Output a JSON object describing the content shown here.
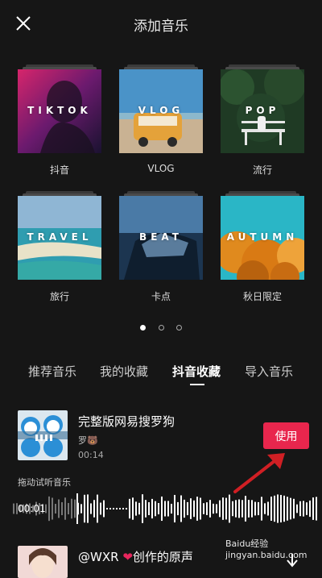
{
  "header": {
    "title": "添加音乐"
  },
  "categories": [
    {
      "cover_text": "TIKTOK",
      "label": "抖音"
    },
    {
      "cover_text": "VLOG",
      "label": "VLOG"
    },
    {
      "cover_text": "POP",
      "label": "流行"
    },
    {
      "cover_text": "TRAVEL",
      "label": "旅行"
    },
    {
      "cover_text": "BEAT",
      "label": "卡点"
    },
    {
      "cover_text": "AUTUMN",
      "label": "秋日限定"
    }
  ],
  "pagination": {
    "total": 3,
    "current": 1
  },
  "tabs": [
    {
      "label": "推荐音乐"
    },
    {
      "label": "我的收藏"
    },
    {
      "label": "抖音收藏",
      "active": true
    },
    {
      "label": "导入音乐"
    }
  ],
  "song": {
    "title": "完整版网易搜罗狗",
    "artist": "罗🐻",
    "duration": "00:14",
    "use_label": "使用"
  },
  "preview": {
    "hint": "拖动试听音乐",
    "current_time": "00:01"
  },
  "song2": {
    "title_prefix": "@WXR",
    "title_suffix": "创作的原声"
  },
  "watermark": "Baidu经验 jingyan.baidu.com",
  "colors": {
    "accent": "#e8264d",
    "background": "#161616"
  }
}
